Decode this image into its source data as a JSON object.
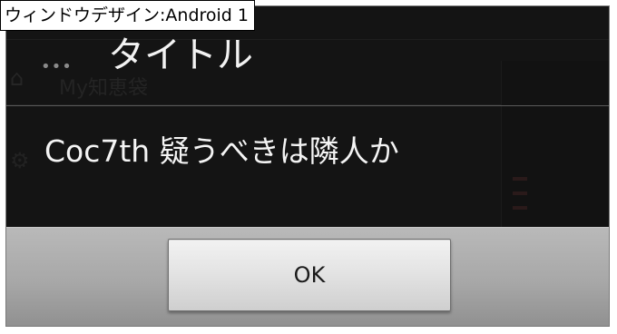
{
  "caption": {
    "text": "ウィンドウデザイン:Android 1"
  },
  "background_app": {
    "title": "My知恵袋"
  },
  "dialog": {
    "title": "タイトル",
    "menu_dots": "•••",
    "message": "Coc7th 疑うべきは隣人か",
    "ok_label": "OK"
  },
  "colors": {
    "dialog_background": "#101010",
    "button_bar": "#a7a7a7",
    "button_face": "#e4e4e4",
    "title_text": "#f2f2f2"
  }
}
